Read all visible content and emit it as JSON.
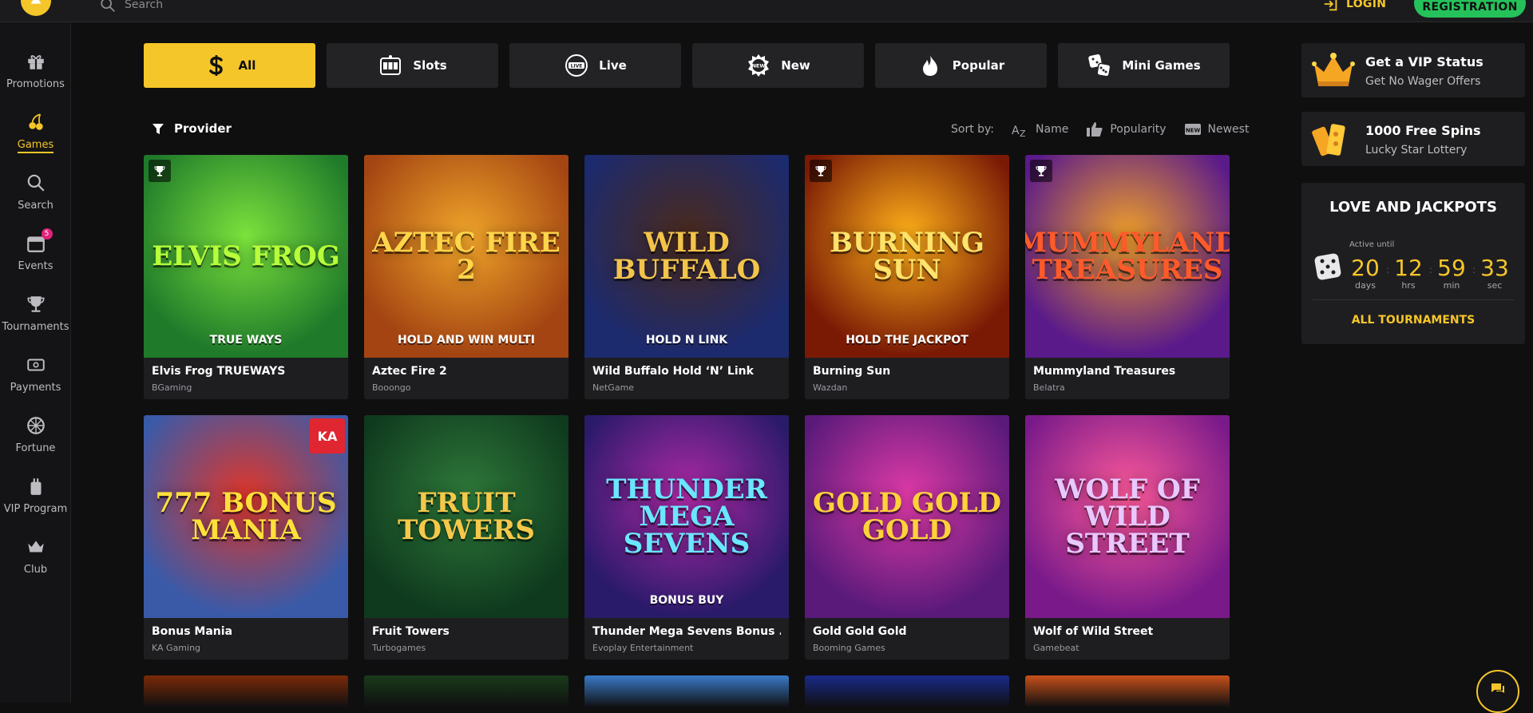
{
  "header": {
    "search_placeholder": "Search",
    "login_label": "LOGIN",
    "register_label": "REGISTRATION"
  },
  "sidebar": {
    "items": [
      {
        "label": "Promotions",
        "icon": "gift-icon"
      },
      {
        "label": "Games",
        "icon": "cherries-icon",
        "active": true
      },
      {
        "label": "Search",
        "icon": "search-icon"
      },
      {
        "label": "Events",
        "icon": "calendar-icon",
        "badge": "5"
      },
      {
        "label": "Tournaments",
        "icon": "trophy-icon"
      },
      {
        "label": "Payments",
        "icon": "wallet-icon"
      },
      {
        "label": "Fortune",
        "icon": "wheel-icon"
      },
      {
        "label": "VIP Program",
        "icon": "vip-icon"
      },
      {
        "label": "Club",
        "icon": "crown-icon"
      }
    ]
  },
  "tabs": [
    {
      "label": "All",
      "icon": "dollar-icon",
      "active": true
    },
    {
      "label": "Slots",
      "icon": "slot-machine-icon"
    },
    {
      "label": "Live",
      "icon": "live-icon"
    },
    {
      "label": "New",
      "icon": "new-icon"
    },
    {
      "label": "Popular",
      "icon": "fire-icon"
    },
    {
      "label": "Mini Games",
      "icon": "dice-icon"
    }
  ],
  "filters": {
    "provider_label": "Provider",
    "sort_label": "Sort by:",
    "sort_options": [
      {
        "label": "Name",
        "icon": "az-icon"
      },
      {
        "label": "Popularity",
        "icon": "thumbs-up-icon"
      },
      {
        "label": "Newest",
        "icon": "new-badge-icon"
      }
    ]
  },
  "games": [
    {
      "name": "Elvis Frog TRUEWAYS",
      "provider": "BGaming",
      "art": "ELVIS FROG",
      "art2": "TRUE WAYS",
      "bg": "#1f7a2a",
      "bg2": "#7be23c",
      "fg": "#b7ff3a",
      "trophy": true
    },
    {
      "name": "Aztec Fire 2",
      "provider": "Booongo",
      "art": "AZTEC FIRE 2",
      "art2": "HOLD AND WIN MULTI",
      "bg": "#a34412",
      "bg2": "#f0a52a",
      "fg": "#ffd54a",
      "trophy": false
    },
    {
      "name": "Wild Buffalo Hold ‘N’ Link",
      "provider": "NetGame",
      "art": "WILD BUFFALO",
      "art2": "HOLD N LINK",
      "bg": "#1c2a6e",
      "bg2": "#4a2a1c",
      "fg": "#f3c44a",
      "trophy": false
    },
    {
      "name": "Burning Sun",
      "provider": "Wazdan",
      "art": "BURNING SUN",
      "art2": "HOLD THE JACKPOT",
      "bg": "#7a1a05",
      "bg2": "#ffb11a",
      "fg": "#ffe36a",
      "trophy": true
    },
    {
      "name": "Mummyland Treasures",
      "provider": "Belatra",
      "art": "MUMMYLAND TREASURES",
      "art2": "",
      "bg": "#5a1a8a",
      "bg2": "#f0a02a",
      "fg": "#ff5a2a",
      "trophy": true
    },
    {
      "name": "Bonus Mania",
      "provider": "KA Gaming",
      "art": "777 BONUS MANIA",
      "art2": "",
      "bg": "#3a5aa8",
      "bg2": "#e0362a",
      "fg": "#ffe03a",
      "trophy": false,
      "ka": "KA"
    },
    {
      "name": "Fruit Towers",
      "provider": "Turbogames",
      "art": "FRUIT TOWERS",
      "art2": "",
      "bg": "#0f3a1e",
      "bg2": "#2f7a3a",
      "fg": "#f5c84a",
      "trophy": false
    },
    {
      "name": "Thunder Mega Sevens Bonus ...",
      "provider": "Evoplay Entertainment",
      "art": "THUNDER MEGA SEVENS",
      "art2": "BONUS BUY",
      "bg": "#2a1a6a",
      "bg2": "#b02aa8",
      "fg": "#6ae6ff",
      "trophy": false
    },
    {
      "name": "Gold Gold Gold",
      "provider": "Booming Games",
      "art": "GOLD GOLD GOLD",
      "art2": "",
      "bg": "#5a1a7a",
      "bg2": "#e03aa8",
      "fg": "#ffd23a",
      "trophy": false
    },
    {
      "name": "Wolf of Wild Street",
      "provider": "Gamebeat",
      "art": "WOLF OF WILD STREET",
      "art2": "",
      "bg": "#7a1a8a",
      "bg2": "#ff5a9a",
      "fg": "#e8c8ff",
      "trophy": false
    }
  ],
  "peek_colors": [
    "#7a2a08",
    "#1a3a1a",
    "#3a7ac8",
    "#1a2a8a",
    "#c8501a"
  ],
  "right_panel": {
    "vip": {
      "title": "Get a VIP Status",
      "subtitle": "Get No Wager Offers",
      "icon": "crown-icon"
    },
    "spins": {
      "title": "1000 Free Spins",
      "subtitle": "Lucky Star Lottery",
      "icon": "tickets-icon"
    },
    "tournament": {
      "title": "LOVE AND JACKPOTS",
      "active_until": "Active until",
      "countdown": [
        {
          "value": "20",
          "unit": "days"
        },
        {
          "value": "12",
          "unit": "hrs"
        },
        {
          "value": "59",
          "unit": "min"
        },
        {
          "value": "33",
          "unit": "sec"
        }
      ],
      "all_label": "ALL TOURNAMENTS"
    }
  },
  "colors": {
    "accent": "#f5c629",
    "register": "#25c25b",
    "badge": "#e0237a"
  }
}
